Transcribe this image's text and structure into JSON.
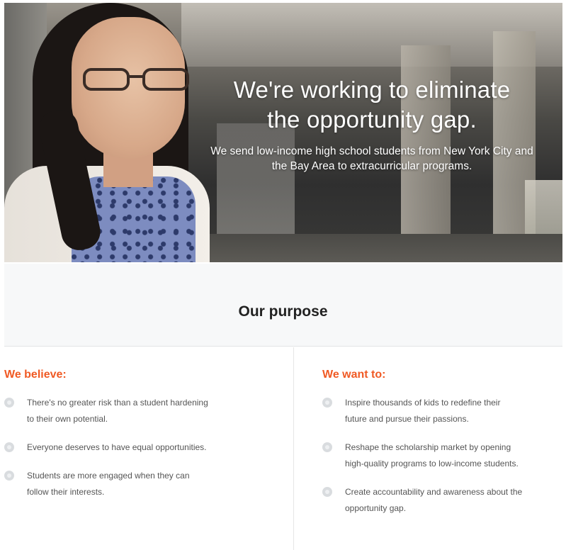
{
  "hero": {
    "title_line1": "We're working to eliminate",
    "title_line2": "the opportunity gap.",
    "subtitle": "We send low-income high school students from New York City and the Bay Area to extracurricular programs."
  },
  "purpose": {
    "title": "Our purpose"
  },
  "believe": {
    "heading": "We believe:",
    "items": [
      {
        "line1": "There's no greater risk than a student hardening",
        "line2": "to their own potential."
      },
      {
        "line1": "Everyone deserves to have equal opportunities.",
        "line2": ""
      },
      {
        "line1": "Students are more engaged when they can",
        "line2": "follow their interests."
      }
    ]
  },
  "want": {
    "heading": "We want to:",
    "items": [
      {
        "line1": "Inspire thousands of kids to redefine their",
        "line2": "future and pursue their passions."
      },
      {
        "line1": "Reshape the scholarship market by opening",
        "line2": "high-quality programs to low-income students."
      },
      {
        "line1": "Create accountability and awareness about the",
        "line2": "opportunity gap."
      }
    ]
  },
  "colors": {
    "accent": "#f05a24",
    "bullet": "#d9dcdf",
    "band": "#f7f8f9"
  },
  "icons": {
    "bullet": "circle-bullet-icon"
  }
}
